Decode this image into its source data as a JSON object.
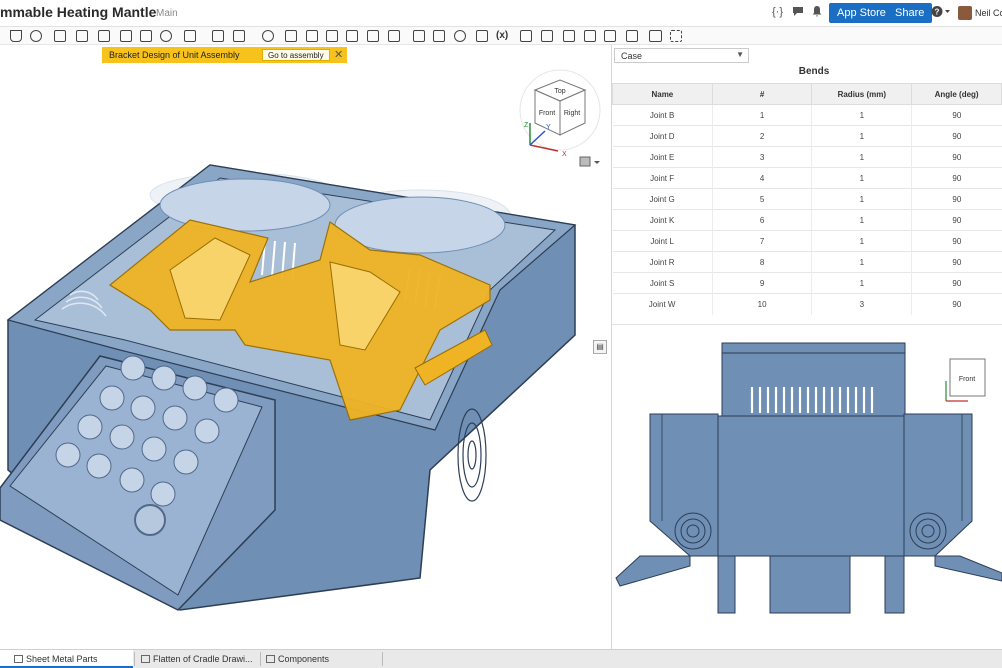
{
  "header": {
    "doc_title": "mmable Heating Mantle",
    "branch": "Main",
    "icons": [
      "versions-icon",
      "comments-icon",
      "notifications-icon",
      "help-icon"
    ],
    "app_store_label": "App Store",
    "share_label": "Share",
    "user_name": "Neil Co"
  },
  "toolbar": {
    "variable_label": "(x)",
    "icons": [
      "sketch-icon",
      "extrude-icon",
      "revolve-icon",
      "sweep-icon",
      "loft-icon",
      "thicken-icon",
      "fillet-icon",
      "chamfer-icon",
      "pattern-icon",
      "boolean-icon",
      "split-icon",
      "transform-icon",
      "mirror-icon",
      "plane-icon",
      "helix-icon",
      "sheet-metal-icon",
      "flange-icon",
      "tab-icon",
      "bend-icon",
      "form-icon",
      "joint-icon",
      "corner-icon",
      "table-icon",
      "flat-icon",
      "finish-icon",
      "variable-icon",
      "measure-icon",
      "section-icon",
      "check-icon",
      "appearance-icon",
      "feature-script-icon",
      "add-icon"
    ]
  },
  "notification": {
    "text": "Bracket Design of Unit Assembly",
    "action_label": "Go to assembly",
    "close_glyph": "✕"
  },
  "viewcube": {
    "top_label": "Top",
    "front_label": "Front",
    "right_label": "Right",
    "axis_x": "X",
    "axis_y": "Y",
    "axis_z": "Z"
  },
  "right_panel": {
    "part_select_value": "Case",
    "bends_title": "Bends",
    "columns": [
      "Name",
      "#",
      "Radius (mm)",
      "Angle (deg)"
    ],
    "rows": [
      [
        "Joint B",
        "1",
        "1",
        "90"
      ],
      [
        "Joint D",
        "2",
        "1",
        "90"
      ],
      [
        "Joint E",
        "3",
        "1",
        "90"
      ],
      [
        "Joint F",
        "4",
        "1",
        "90"
      ],
      [
        "Joint G",
        "5",
        "1",
        "90"
      ],
      [
        "Joint K",
        "6",
        "1",
        "90"
      ],
      [
        "Joint L",
        "7",
        "1",
        "90"
      ],
      [
        "Joint R",
        "8",
        "1",
        "90"
      ],
      [
        "Joint S",
        "9",
        "1",
        "90"
      ],
      [
        "Joint W",
        "10",
        "3",
        "90"
      ]
    ],
    "flat_viewcube_label": "Front"
  },
  "tabs": [
    {
      "label": "Sheet Metal Parts",
      "active": true
    },
    {
      "label": "Flatten of Cradle Drawi...",
      "active": false
    },
    {
      "label": "Components",
      "active": false
    }
  ],
  "colors": {
    "accent": "#1a6fc4",
    "notice": "#f7c21b",
    "part_blue": "#6f8fb5",
    "bracket_yellow": "#f0b323"
  }
}
